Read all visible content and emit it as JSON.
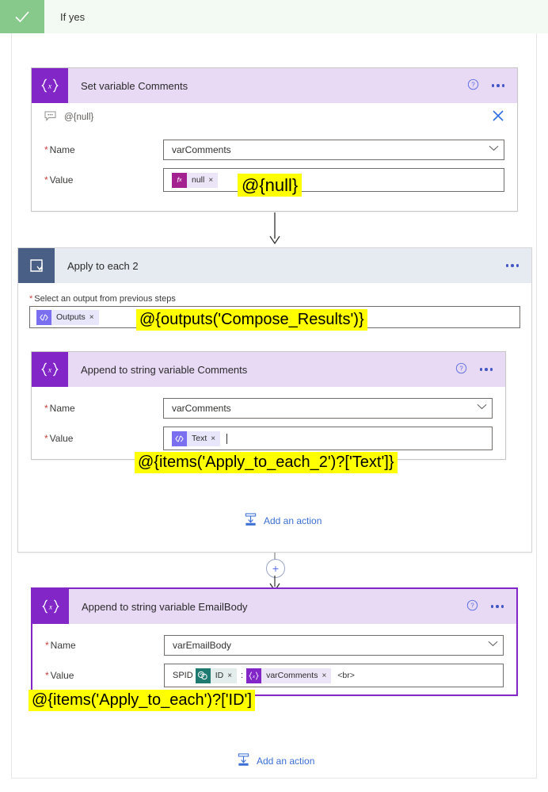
{
  "branch": {
    "label": "If yes",
    "check_icon": "checkmark-icon",
    "accent": "#86c98a",
    "background": "#f3faf3"
  },
  "cards": {
    "set_variable_comments": {
      "icon": "variable-braces-icon",
      "title": "Set variable Comments",
      "help_icon": "help-circle-icon",
      "menu_icon": "ellipsis-icon",
      "comment": {
        "icon": "comment-bubble-icon",
        "text": "@{null}",
        "close_icon": "close-icon"
      },
      "fields": [
        {
          "label": "Name",
          "required": true,
          "value": "varComments",
          "control": "dropdown"
        },
        {
          "label": "Value",
          "required": true,
          "control": "token-input",
          "tokens": [
            {
              "icon": "fx-icon",
              "label": "null",
              "remove": "×",
              "style": "fx"
            }
          ]
        }
      ]
    },
    "apply_to_each_2": {
      "icon": "loop-icon",
      "title": "Apply to each 2",
      "menu_icon": "ellipsis-icon",
      "field": {
        "label": "Select an output from previous steps",
        "required": true,
        "tokens": [
          {
            "icon": "expression-icon",
            "label": "Outputs",
            "remove": "×",
            "style": "outputs"
          }
        ]
      },
      "add_action": {
        "icon": "add-action-icon",
        "label": "Add an action"
      }
    },
    "append_comments": {
      "icon": "variable-braces-icon",
      "title": "Append to string variable Comments",
      "help_icon": "help-circle-icon",
      "menu_icon": "ellipsis-icon",
      "fields": [
        {
          "label": "Name",
          "required": true,
          "value": "varComments",
          "control": "dropdown"
        },
        {
          "label": "Value",
          "required": true,
          "control": "token-input",
          "tokens": [
            {
              "icon": "expression-icon",
              "label": "Text",
              "remove": "×",
              "style": "outputs"
            }
          ]
        }
      ]
    },
    "append_emailbody": {
      "icon": "variable-braces-icon",
      "title": "Append to string variable EmailBody",
      "help_icon": "help-circle-icon",
      "menu_icon": "ellipsis-icon",
      "selected": true,
      "selected_border": "#8226c8",
      "fields": [
        {
          "label": "Name",
          "required": true,
          "value": "varEmailBody",
          "control": "dropdown"
        },
        {
          "label": "Value",
          "required": true,
          "control": "token-input",
          "prefix_text": "SPID",
          "tokens": [
            {
              "icon": "sharepoint-icon",
              "label": "ID",
              "remove": "×",
              "style": "sp"
            },
            {
              "icon": "variable-braces-icon",
              "label": "varComments",
              "remove": "×",
              "style": "varx"
            }
          ],
          "separator_text": ":",
          "suffix_text": "<br>"
        }
      ]
    }
  },
  "add_actions": {
    "inside_loop": {
      "icon": "add-action-icon",
      "label": "Add an action"
    },
    "bottom": {
      "icon": "add-action-icon",
      "label": "Add an action"
    }
  },
  "connectors": {
    "plus_node": "add-step-plus-icon"
  },
  "annotations": [
    {
      "id": "annotation-null",
      "text": "@{null}"
    },
    {
      "id": "annotation-outputs",
      "text": "@{outputs('Compose_Results')}"
    },
    {
      "id": "annotation-items-text",
      "text": "@{items('Apply_to_each_2')?['Text']}"
    },
    {
      "id": "annotation-items-id",
      "text": "@{items('Apply_to_each')?['ID']"
    }
  ],
  "colors": {
    "variable_purple": "#8226c8",
    "loop_slate": "#4a5f85",
    "card_header_lavender": "#e8d9f5",
    "loop_header_gray": "#e6eaf1",
    "branch_green": "#86c98a",
    "highlight_yellow": "#ffff00",
    "link_blue": "#3b6fd4"
  }
}
